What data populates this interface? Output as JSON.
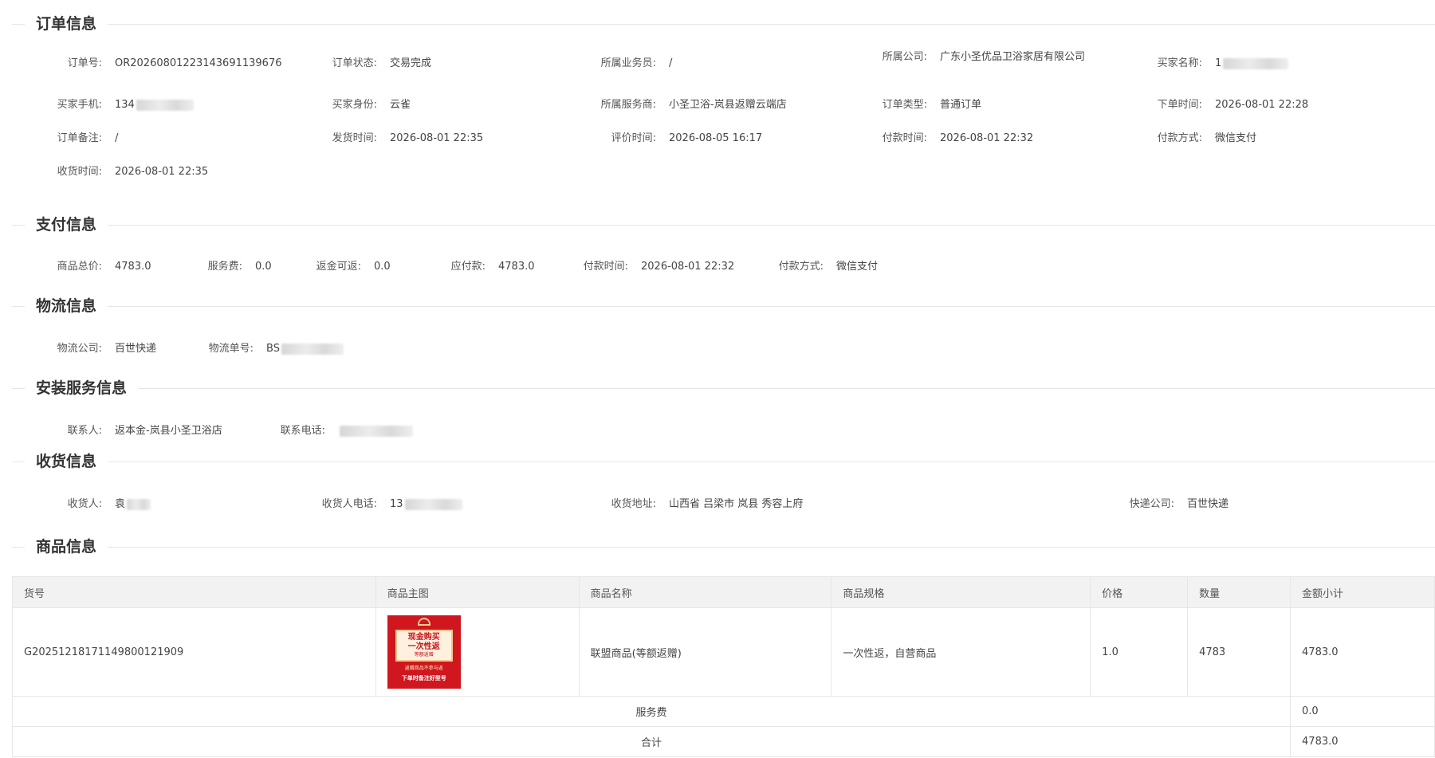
{
  "order_info": {
    "title": "订单信息",
    "fields": {
      "order_no": {
        "label": "订单号",
        "value": "OR2026080122314369113967б"
      },
      "order_status": {
        "label": "订单状态",
        "value": "交易完成"
      },
      "salesperson": {
        "label": "所属业务员",
        "value": "/"
      },
      "company": {
        "label": "所属公司",
        "value": "广东小圣优品卫浴家居有限公司"
      },
      "buyer_name": {
        "label": "买家名称",
        "value": "1"
      },
      "buyer_phone": {
        "label": "买家手机",
        "value": "134"
      },
      "buyer_identity": {
        "label": "买家身份",
        "value": "云雀"
      },
      "service_provider": {
        "label": "所属服务商",
        "value": "小圣卫浴-岚县返赠云端店"
      },
      "order_type": {
        "label": "订单类型",
        "value": "普通订单"
      },
      "order_time": {
        "label": "下单时间",
        "value": "2026-08-01 22:28"
      },
      "order_remark": {
        "label": "订单备注",
        "value": "/"
      },
      "ship_time": {
        "label": "发货时间",
        "value": "2026-08-01 22:35"
      },
      "review_time": {
        "label": "评价时间",
        "value": "2026-08-05 16:17"
      },
      "pay_time": {
        "label": "付款时间",
        "value": "2026-08-01 22:32"
      },
      "pay_method": {
        "label": "付款方式",
        "value": "微信支付"
      },
      "receive_time": {
        "label": "收货时间",
        "value": "2026-08-01 22:35"
      }
    }
  },
  "payment_info": {
    "title": "支付信息",
    "fields": {
      "goods_total": {
        "label": "商品总价",
        "value": "4783.0"
      },
      "service_fee": {
        "label": "服务费",
        "value": "0.0"
      },
      "rebate": {
        "label": "返金可返",
        "value": "0.0"
      },
      "payable": {
        "label": "应付款",
        "value": "4783.0"
      },
      "pay_time": {
        "label": "付款时间",
        "value": "2026-08-01 22:32"
      },
      "pay_method": {
        "label": "付款方式",
        "value": "微信支付"
      }
    }
  },
  "logistics_info": {
    "title": "物流信息",
    "fields": {
      "company": {
        "label": "物流公司",
        "value": "百世快递"
      },
      "tracking_no": {
        "label": "物流单号",
        "value": "BS"
      }
    }
  },
  "install_info": {
    "title": "安装服务信息",
    "fields": {
      "contact": {
        "label": "联系人",
        "value": "返本金-岚县小圣卫浴店"
      },
      "contact_phone": {
        "label": "联系电话",
        "value": ""
      }
    }
  },
  "receive_info": {
    "title": "收货信息",
    "fields": {
      "receiver": {
        "label": "收货人",
        "value": "袁"
      },
      "receiver_phone": {
        "label": "收货人电话",
        "value": "13"
      },
      "address": {
        "label": "收货地址",
        "value": "山西省 吕梁市 岚县 秀容上府"
      },
      "express": {
        "label": "快递公司",
        "value": "百世快递"
      }
    }
  },
  "goods_info": {
    "title": "商品信息",
    "columns": [
      "货号",
      "商品主图",
      "商品名称",
      "商品规格",
      "价格",
      "数量",
      "金额小计"
    ],
    "rows": [
      {
        "sku": "G20251218171149800121909",
        "image_text": {
          "line1": "现金购买",
          "line2": "一次性返",
          "line3": "等额返赠",
          "line4": "返赠商品不参与返",
          "line5": "下单时备注好型号"
        },
        "name": "联盟商品(等额返赠)",
        "spec": "一次性返，自营商品",
        "price": "1.0",
        "qty": "4783",
        "subtotal": "4783.0"
      }
    ],
    "service_fee": {
      "label": "服务费",
      "value": "0.0"
    },
    "total": {
      "label": "合计",
      "value": "4783.0"
    }
  }
}
